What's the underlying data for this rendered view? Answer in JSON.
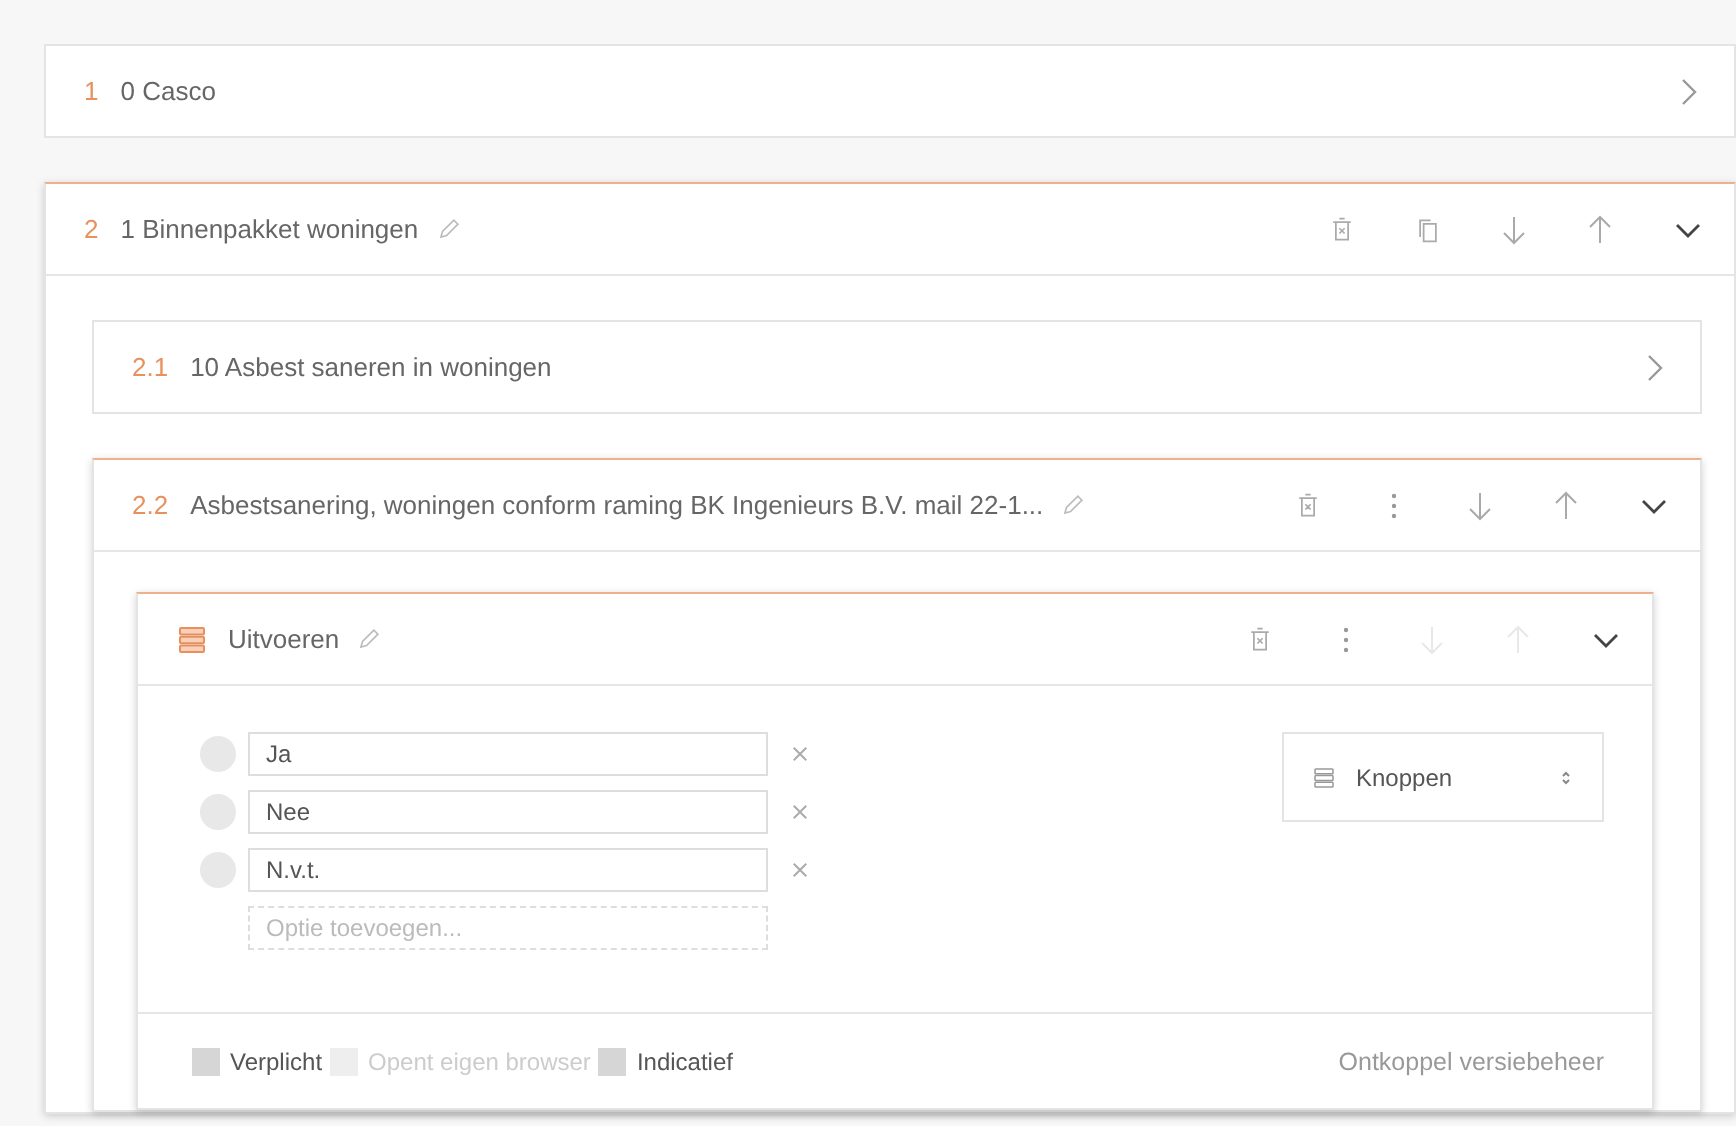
{
  "sections": [
    {
      "kind": "section",
      "number": "1",
      "title": "0 Casco",
      "editable": false,
      "expanded": false
    },
    {
      "kind": "section",
      "number": "2",
      "title": "1 Binnenpakket woningen",
      "editable": true,
      "expanded": true,
      "actions": [
        {
          "kind": "delete",
          "disabled": false
        },
        {
          "kind": "copy",
          "disabled": false
        },
        {
          "kind": "move-down",
          "disabled": false
        },
        {
          "kind": "move-up",
          "disabled": false
        }
      ],
      "children": [
        {
          "kind": "section",
          "number": "2.1",
          "title": "10 Asbest saneren in woningen",
          "editable": false,
          "expanded": false
        },
        {
          "kind": "section",
          "number": "2.2",
          "title": "Asbestsanering, woningen conform raming BK Ingenieurs B.V. mail 22-1...",
          "editable": true,
          "expanded": true,
          "actions": [
            {
              "kind": "delete",
              "disabled": false
            },
            {
              "kind": "more",
              "disabled": false
            },
            {
              "kind": "move-down",
              "disabled": false
            },
            {
              "kind": "move-up",
              "disabled": false
            }
          ],
          "children": [
            {
              "kind": "question",
              "title": "Uitvoeren",
              "editable": true,
              "expanded": true,
              "actions": [
                {
                  "kind": "delete",
                  "disabled": false
                },
                {
                  "kind": "more",
                  "disabled": false
                },
                {
                  "kind": "move-down",
                  "disabled": true
                },
                {
                  "kind": "move-up",
                  "disabled": true
                }
              ],
              "options": [
                {
                  "value": "Ja",
                  "selected": false
                },
                {
                  "value": "Nee",
                  "selected": false
                },
                {
                  "value": "N.v.t.",
                  "selected": false
                }
              ],
              "add_option": {
                "placeholder": "Optie toevoegen..."
              },
              "answer_type": "Knoppen",
              "flags": [
                {
                  "label": "Verplicht",
                  "checked": false,
                  "disabled": false
                },
                {
                  "label": "Opent eigen browser",
                  "checked": false,
                  "disabled": true
                },
                {
                  "label": "Indicatief",
                  "checked": false,
                  "disabled": false
                }
              ],
              "footer_link": "Ontkoppel versiebeheer"
            }
          ]
        }
      ]
    }
  ]
}
